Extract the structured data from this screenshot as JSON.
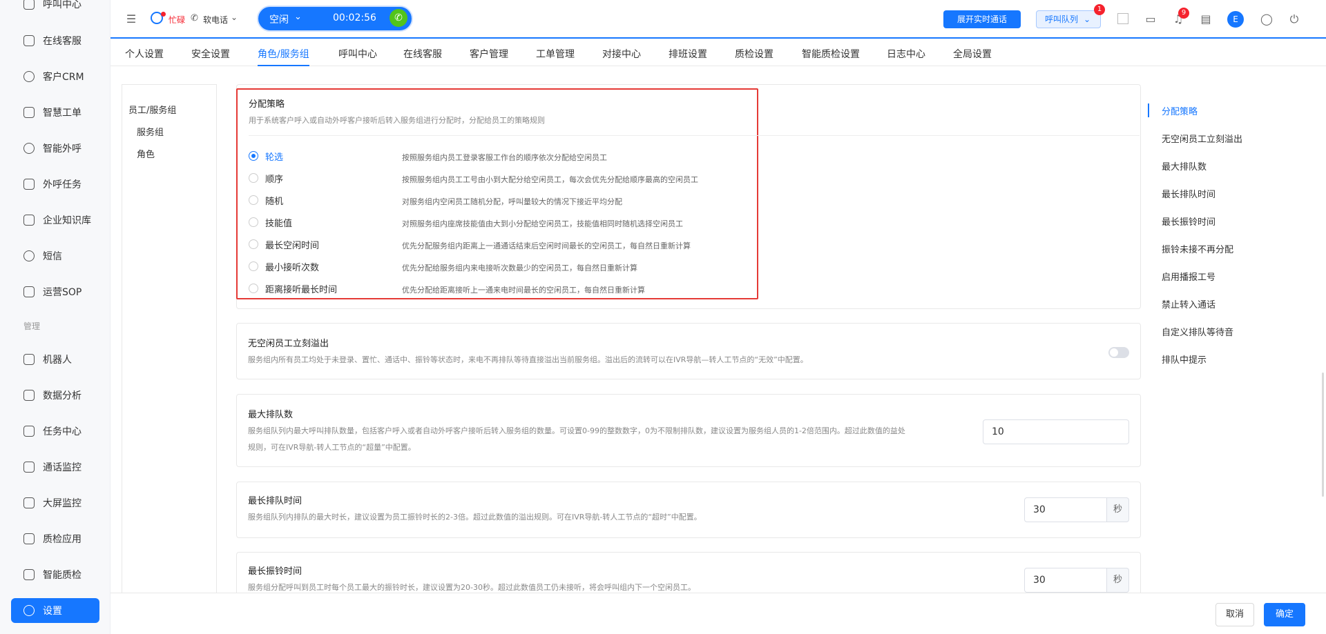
{
  "sidebar": {
    "items": [
      {
        "label": "呼叫中心",
        "icon": "phone-icon"
      },
      {
        "label": "在线客服",
        "icon": "headset-icon"
      },
      {
        "label": "客户CRM",
        "icon": "user-icon"
      },
      {
        "label": "智慧工单",
        "icon": "document-icon"
      },
      {
        "label": "智能外呼",
        "icon": "call-out-icon"
      },
      {
        "label": "外呼任务",
        "icon": "phone-task-icon"
      },
      {
        "label": "企业知识库",
        "icon": "book-icon"
      },
      {
        "label": "短信",
        "icon": "sms-icon"
      },
      {
        "label": "运营SOP",
        "icon": "flow-icon"
      }
    ],
    "section_label": "管理",
    "manage_items": [
      {
        "label": "机器人",
        "icon": "robot-icon"
      },
      {
        "label": "数据分析",
        "icon": "bar-chart-icon"
      },
      {
        "label": "任务中心",
        "icon": "checklist-icon"
      },
      {
        "label": "通话监控",
        "icon": "monitor-icon"
      },
      {
        "label": "大屏监控",
        "icon": "dashboard-icon"
      },
      {
        "label": "质检应用",
        "icon": "inspect-icon"
      },
      {
        "label": "智能质检",
        "icon": "smart-inspect-icon"
      },
      {
        "label": "设置",
        "icon": "gear-icon"
      }
    ]
  },
  "header": {
    "status_text": "忙碌",
    "softphone_label": "软电话",
    "idle_status": "空闲",
    "timer": "00:02:56",
    "realtime_button": "展开实时通话",
    "queue_button": "呼叫队列",
    "queue_badge": "1",
    "notify_badge": "9",
    "avatar_letter": "E"
  },
  "tabs": [
    "个人设置",
    "安全设置",
    "角色/服务组",
    "呼叫中心",
    "在线客服",
    "客户管理",
    "工单管理",
    "对接中心",
    "排班设置",
    "质检设置",
    "智能质检设置",
    "日志中心",
    "全局设置"
  ],
  "active_tab": "角色/服务组",
  "tree": {
    "root": "员工/服务组",
    "children": [
      "服务组",
      "角色"
    ]
  },
  "strategy": {
    "title": "分配策略",
    "desc": "用于系统客户呼入或自动外呼客户接听后转入服务组进行分配时，分配给员工的策略规则",
    "options": [
      {
        "label": "轮选",
        "desc": "按照服务组内员工登录客服工作台的顺序依次分配给空闲员工",
        "checked": true
      },
      {
        "label": "顺序",
        "desc": "按照服务组内员工工号由小到大配分给空闲员工，每次会优先分配给顺序最高的空闲员工",
        "checked": false
      },
      {
        "label": "随机",
        "desc": "对服务组内空闲员工随机分配，呼叫量较大的情况下接近平均分配",
        "checked": false
      },
      {
        "label": "技能值",
        "desc": "对照服务组内座席技能值由大到小分配给空闲员工，技能值相同时随机选择空闲员工",
        "checked": false
      },
      {
        "label": "最长空闲时间",
        "desc": "优先分配服务组内距离上一通通话结束后空闲时间最长的空闲员工，每自然日重新计算",
        "checked": false
      },
      {
        "label": "最小接听次数",
        "desc": "优先分配给服务组内来电接听次数最少的空闲员工，每自然日重新计算",
        "checked": false
      },
      {
        "label": "距离接听最长时间",
        "desc": "优先分配给距离接听上一通来电时间最长的空闲员工，每自然日重新计算",
        "checked": false
      }
    ]
  },
  "overflow": {
    "title": "无空闲员工立刻溢出",
    "desc": "服务组内所有员工均处于未登录、置忙、通话中、振铃等状态时，来电不再排队等待直接溢出当前服务组。溢出后的流转可以在IVR导航—转人工节点的“无效”中配置。",
    "enabled": false
  },
  "max_queue": {
    "title": "最大排队数",
    "desc_line1": "服务组队列内最大呼叫排队数量，包括客户呼入或者自动外呼客户接听后转入服务组的数量。可设置0-99的整数数字，0为不限制排队数，建议设置为服务组人员的1-2倍范围内。超过此数值的益处",
    "desc_line2": "规则，可在IVR导航-转人工节点的“超量”中配置。",
    "value": "10"
  },
  "max_wait": {
    "title": "最长排队时间",
    "desc": "服务组队列内排队的最大时长，建议设置为员工振铃时长的2-3倍。超过此数值的溢出规则。可在IVR导航-转人工节点的“超时”中配置。",
    "value": "30",
    "unit": "秒"
  },
  "max_ring": {
    "title": "最长振铃时间",
    "desc": "服务组分配呼叫到员工时每个员工最大的振铃时长，建议设置为20-30秒。超过此数值员工仍未接听，将会呼叫组内下一个空闲员工。",
    "value": "30",
    "unit": "秒"
  },
  "anchors": [
    "分配策略",
    "无空闲员工立刻溢出",
    "最大排队数",
    "最长排队时间",
    "最长振铃时间",
    "振铃未接不再分配",
    "启用播报工号",
    "禁止转入通话",
    "自定义排队等待音",
    "排队中提示"
  ],
  "footer": {
    "cancel": "取消",
    "confirm": "确定"
  },
  "colors": {
    "accent": "#1677ff",
    "highlight_border": "#e53935",
    "status_busy": "#f5222d",
    "call_green": "#52c41a"
  }
}
